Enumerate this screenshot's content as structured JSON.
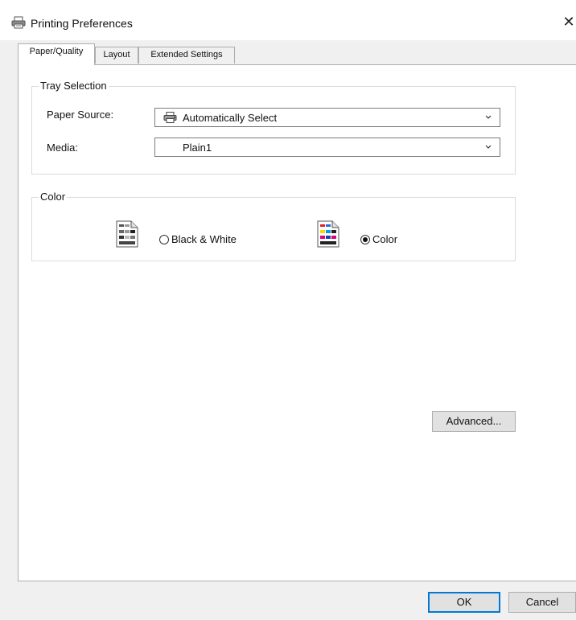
{
  "window": {
    "title": "Printing Preferences",
    "close_glyph": "✕"
  },
  "tabs": [
    {
      "label": "Paper/Quality",
      "active": true
    },
    {
      "label": "Layout",
      "active": false
    },
    {
      "label": "Extended Settings",
      "active": false
    }
  ],
  "tray_selection": {
    "legend": "Tray Selection",
    "paper_source_label": "Paper Source:",
    "paper_source_value": "Automatically Select",
    "media_label": "Media:",
    "media_value": "Plain1"
  },
  "color": {
    "legend": "Color",
    "options": [
      {
        "label": "Black & White",
        "selected": false,
        "icon": "bw-document-icon"
      },
      {
        "label": "Color",
        "selected": true,
        "icon": "color-document-icon"
      }
    ]
  },
  "buttons": {
    "advanced": "Advanced...",
    "ok": "OK",
    "cancel": "Cancel"
  }
}
